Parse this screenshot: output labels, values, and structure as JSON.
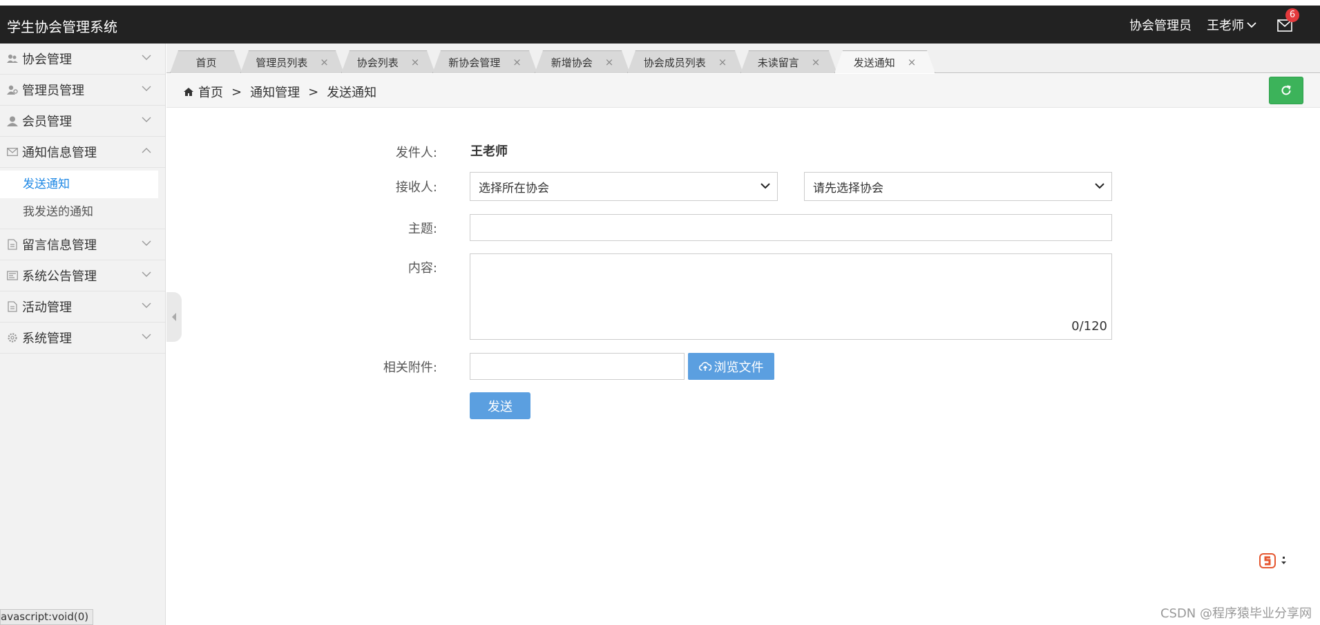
{
  "app": {
    "title": "学生协会管理系统",
    "role": "协会管理员",
    "user": "王老师",
    "mail_count": "6"
  },
  "sidebar": {
    "items": [
      {
        "label": "协会管理",
        "icon": "users-icon"
      },
      {
        "label": "管理员管理",
        "icon": "admin-icon"
      },
      {
        "label": "会员管理",
        "icon": "user-icon"
      },
      {
        "label": "通知信息管理",
        "icon": "envelope-icon"
      },
      {
        "label": "留言信息管理",
        "icon": "document-icon"
      },
      {
        "label": "系统公告管理",
        "icon": "announcement-icon"
      },
      {
        "label": "活动管理",
        "icon": "document-icon"
      },
      {
        "label": "系统管理",
        "icon": "gear-icon"
      }
    ],
    "sub_items": [
      {
        "label": "发送通知",
        "active": true
      },
      {
        "label": "我发送的通知",
        "active": false
      }
    ]
  },
  "tabs": [
    {
      "label": "首页",
      "closable": false
    },
    {
      "label": "管理员列表",
      "closable": true
    },
    {
      "label": "协会列表",
      "closable": true
    },
    {
      "label": "新协会管理",
      "closable": true
    },
    {
      "label": "新增协会",
      "closable": true
    },
    {
      "label": "协会成员列表",
      "closable": true
    },
    {
      "label": "未读留言",
      "closable": true
    },
    {
      "label": "发送通知",
      "closable": true,
      "active": true
    }
  ],
  "tab_close_glyph": "×",
  "breadcrumb": {
    "home": "首页",
    "sep": ">",
    "level1": "通知管理",
    "level2": "发送通知"
  },
  "form": {
    "sender_label": "发件人:",
    "sender_value": "王老师",
    "receiver_label": "接收人:",
    "association_select": "选择所在协会",
    "member_select": "请先选择协会",
    "subject_label": "主题:",
    "subject_value": "",
    "content_label": "内容:",
    "content_value": "",
    "content_counter": "0/120",
    "attachment_label": "相关附件:",
    "browse_button": "浏览文件",
    "send_button": "发送"
  },
  "statusbar": {
    "text": "avascript:void(0)"
  },
  "watermark": "CSDN @程序猿毕业分享网",
  "colors": {
    "topbar": "#222222",
    "primary_button": "#5b9fe0",
    "refresh_button": "#3cb35a",
    "active_link": "#1e88e5",
    "badge": "#e4393c"
  }
}
